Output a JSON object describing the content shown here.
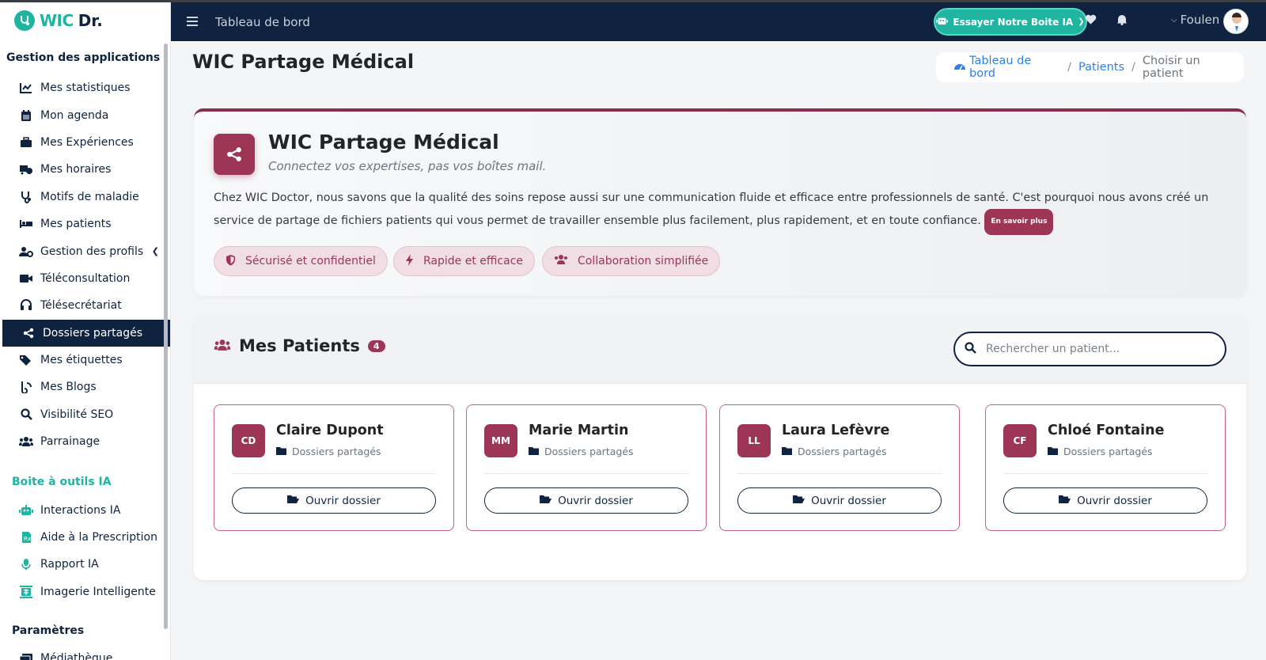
{
  "app": {
    "logo_prefix": "WIC",
    "logo_suffix": "Dr.",
    "brand_colors": {
      "navy": "#0f2340",
      "teal": "#1fb5a0",
      "burgundy": "#9c3556"
    }
  },
  "sidebar": {
    "section_apps": "Gestion des applications",
    "items": [
      {
        "label": "Mes statistiques",
        "icon": "chart-line-icon"
      },
      {
        "label": "Mon agenda",
        "icon": "calendar-icon"
      },
      {
        "label": "Mes Expériences",
        "icon": "briefcase-icon"
      },
      {
        "label": "Mes horaires",
        "icon": "truck-clock-icon"
      },
      {
        "label": "Motifs de maladie",
        "icon": "stethoscope-icon"
      },
      {
        "label": "Mes patients",
        "icon": "bed-icon"
      },
      {
        "label": "Gestion des profils",
        "icon": "user-gear-icon"
      },
      {
        "label": "Téléconsultation",
        "icon": "video-icon"
      },
      {
        "label": "Télésecrétariat",
        "icon": "headset-icon"
      },
      {
        "label": "Dossiers partagés",
        "icon": "share-icon"
      },
      {
        "label": "Mes étiquettes",
        "icon": "tags-icon"
      },
      {
        "label": "Mes Blogs",
        "icon": "blog-icon"
      },
      {
        "label": "Visibilité SEO",
        "icon": "search-icon"
      },
      {
        "label": "Parrainage",
        "icon": "users-icon"
      }
    ],
    "section_ai": "Boite à outils IA",
    "ai_items": [
      {
        "label": "Interactions IA",
        "icon": "robot-icon"
      },
      {
        "label": "Aide à la Prescription",
        "icon": "prescription-icon"
      },
      {
        "label": "Rapport IA",
        "icon": "microphone-icon"
      },
      {
        "label": "Imagerie Intelligente",
        "icon": "x-ray-icon"
      }
    ],
    "section_params": "Paramètres",
    "param_items": [
      {
        "label": "Médiathèque",
        "icon": "photo-film-icon"
      }
    ]
  },
  "header": {
    "title": "Tableau de bord",
    "try_ai_label": "Essayer Notre Boite IA",
    "user_name": "Foulen"
  },
  "main": {
    "page_title": "WIC Partage Médical",
    "breadcrumb": {
      "home": "Tableau de bord",
      "patients": "Patients",
      "current": "Choisir un patient"
    },
    "intro": {
      "title": "WIC Partage Médical",
      "subtitle": "Connectez vos expertises, pas vos boîtes mail.",
      "description": "Chez WIC Doctor, nous savons que la qualité des soins repose aussi sur une communication fluide et efficace entre professionnels de santé. C'est pourquoi nous avons créé un service de partage de fichiers patients qui vous permet de travailler ensemble plus facilement, plus rapidement, et en toute confiance.",
      "more_label": "En savoir plus",
      "features": [
        {
          "label": "Sécurisé et confidentiel",
          "icon": "shield-icon"
        },
        {
          "label": "Rapide et efficace",
          "icon": "bolt-icon"
        },
        {
          "label": "Collaboration simplifiée",
          "icon": "users-icon"
        }
      ]
    },
    "patients_section": {
      "title": "Mes Patients",
      "count": "4",
      "search_placeholder": "Rechercher un patient...",
      "folder_label": "Dossiers partagés",
      "open_label": "Ouvrir dossier",
      "patients": [
        {
          "initials": "CD",
          "name": "Claire Dupont"
        },
        {
          "initials": "MM",
          "name": "Marie Martin"
        },
        {
          "initials": "LL",
          "name": "Laura Lefèvre"
        },
        {
          "initials": "CF",
          "name": "Chloé Fontaine"
        }
      ]
    }
  }
}
